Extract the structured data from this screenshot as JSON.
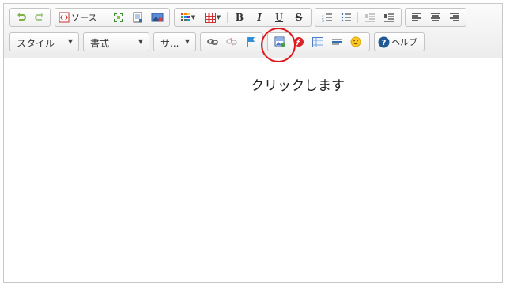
{
  "toolbar": {
    "row1": {
      "source_label": "ソース",
      "bold_label": "B",
      "italic_label": "I",
      "underline_label": "U",
      "strike_label": "S"
    },
    "row2": {
      "style_combo": "スタイル",
      "format_combo": "書式",
      "size_combo": "サ...",
      "help_label": "ヘルプ"
    }
  },
  "content": {
    "text": "クリックします"
  },
  "colors": {
    "highlight_circle": "#e0161b",
    "help_icon": "#1f5a94",
    "flash_icon": "#d8242a"
  },
  "icons": [
    "undo-icon",
    "redo-icon",
    "source-icon",
    "maximize-icon",
    "preview-icon",
    "image-icon",
    "text-color-icon",
    "table-icon",
    "numbered-list-icon",
    "bulleted-list-icon",
    "outdent-icon",
    "indent-icon",
    "align-left-icon",
    "align-center-icon",
    "align-right-icon",
    "link-icon",
    "unlink-icon",
    "anchor-icon",
    "insert-image-icon",
    "flash-icon",
    "table-insert-icon",
    "horizontal-rule-icon",
    "smiley-icon",
    "help-icon"
  ]
}
